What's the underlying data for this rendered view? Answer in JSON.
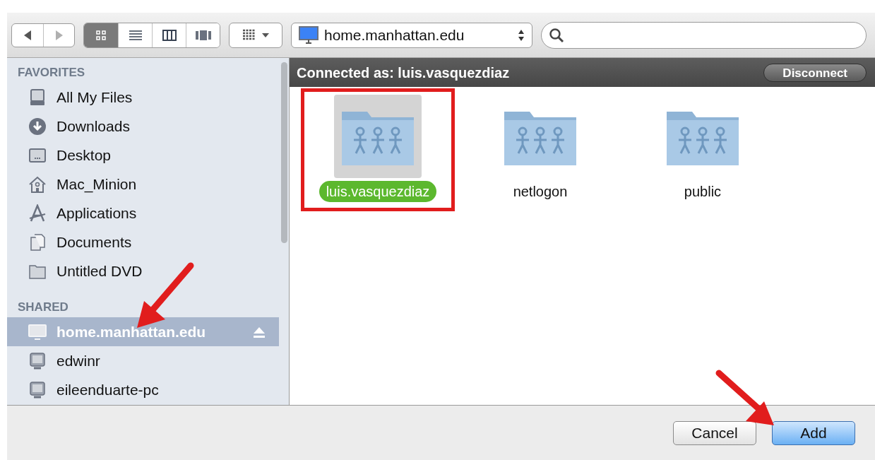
{
  "toolbar": {
    "nav": [
      {
        "kind": "back",
        "disabled": false
      },
      {
        "kind": "forward",
        "disabled": true
      }
    ],
    "view_modes": [
      {
        "kind": "icons",
        "selected": true
      },
      {
        "kind": "list",
        "selected": false
      },
      {
        "kind": "columns",
        "selected": false
      },
      {
        "kind": "coverflow",
        "selected": false
      }
    ],
    "path": "home.manhattan.edu"
  },
  "sidebar": {
    "sections": [
      {
        "heading": "FAVORITES",
        "items": [
          {
            "label": "All My Files",
            "kind": "files",
            "selected": false,
            "eject": false
          },
          {
            "label": "Downloads",
            "kind": "downloads",
            "selected": false,
            "eject": false
          },
          {
            "label": "Desktop",
            "kind": "desktop",
            "selected": false,
            "eject": false
          },
          {
            "label": "Mac_Minion",
            "kind": "home",
            "selected": false,
            "eject": false
          },
          {
            "label": "Applications",
            "kind": "applications",
            "selected": false,
            "eject": false
          },
          {
            "label": "Documents",
            "kind": "documents",
            "selected": false,
            "eject": false
          },
          {
            "label": "Untitled DVD",
            "kind": "folder",
            "selected": false,
            "eject": false
          }
        ]
      },
      {
        "heading": "SHARED",
        "items": [
          {
            "label": "home.manhattan.edu",
            "kind": "server",
            "selected": true,
            "eject": true
          },
          {
            "label": "edwinr",
            "kind": "pc",
            "selected": false,
            "eject": false
          },
          {
            "label": "eileenduarte-pc",
            "kind": "pc",
            "selected": false,
            "eject": false
          }
        ]
      }
    ]
  },
  "connection": {
    "status": "Connected as: luis.vasquezdiaz",
    "button": "Disconnect"
  },
  "folders": [
    {
      "name": "luis.vasquezdiaz",
      "selected": true,
      "highlighted": true
    },
    {
      "name": "netlogon",
      "selected": false,
      "highlighted": false
    },
    {
      "name": "public",
      "selected": false,
      "highlighted": false
    }
  ],
  "buttons": [
    {
      "label": "Cancel",
      "kind": "normal"
    },
    {
      "label": "Add",
      "kind": "default"
    }
  ]
}
